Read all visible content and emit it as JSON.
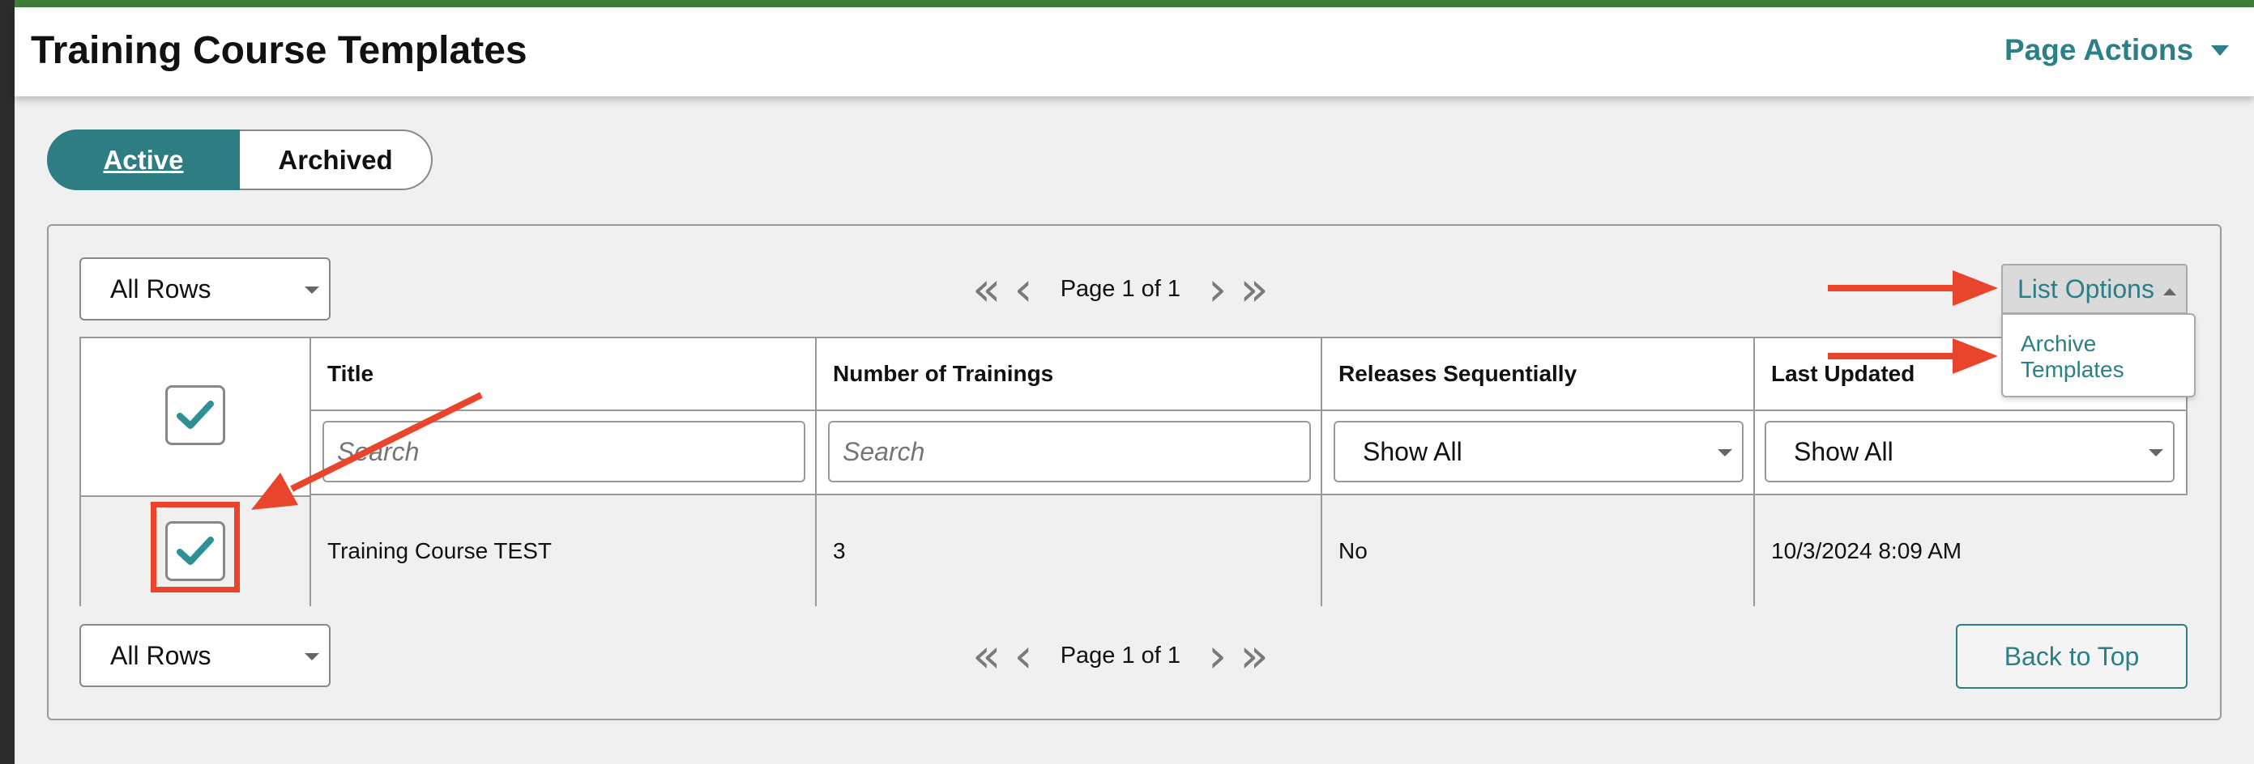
{
  "header": {
    "title": "Training Course Templates",
    "page_actions_label": "Page Actions"
  },
  "tabs": [
    {
      "label": "Active",
      "selected": true
    },
    {
      "label": "Archived",
      "selected": false
    }
  ],
  "toolbar": {
    "rows_select_value": "All Rows",
    "pager_text": "Page 1 of 1",
    "list_options_label": "List Options",
    "list_options_menu": [
      "Archive Templates"
    ]
  },
  "table": {
    "headers": [
      "Title",
      "Number of Trainings",
      "Releases Sequentially",
      "Last Updated"
    ],
    "filters": {
      "title_placeholder": "Search",
      "trainings_placeholder": "Search",
      "releases_value": "Show All",
      "updated_value": "Show All"
    },
    "rows": [
      {
        "checked": true,
        "title": "Training Course TEST",
        "trainings": "3",
        "releases": "No",
        "updated": "10/3/2024 8:09 AM"
      }
    ],
    "select_all_checked": true
  },
  "footer": {
    "rows_select_value": "All Rows",
    "pager_text": "Page 1 of 1",
    "back_to_top_label": "Back to Top"
  },
  "colors": {
    "accent": "#2e7d82",
    "annotation": "#e8452c",
    "top_bar": "#3e7d3a"
  }
}
